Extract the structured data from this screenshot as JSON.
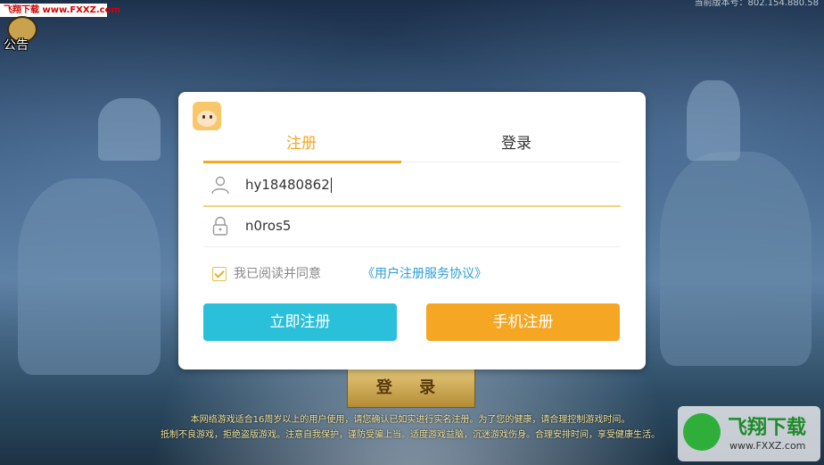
{
  "watermark_top": "飞翔下载 www.FXXZ.com",
  "notice_label": "公告",
  "version_text": "当前版本号：802.154.880.58",
  "dialog": {
    "tabs": [
      {
        "label": "注册",
        "active": true
      },
      {
        "label": "登录",
        "active": false
      }
    ],
    "username_value": "hy18480862",
    "password_value": "n0ros5",
    "user_icon": "user-icon",
    "lock_icon": "lock-icon",
    "agree_text": "我已阅读并同意",
    "agree_link": "《用户注册服务协议》",
    "agree_checked": true,
    "register_button": "立即注册",
    "phone_register_button": "手机注册"
  },
  "game_login_button": "登 录",
  "disclaimer_lines": [
    "本网络游戏适合16周岁以上的用户使用，请您确认已如实进行实名注册。为了您的健康，请合理控制游戏时间。",
    "抵制不良游戏，拒绝盗版游戏。注意自我保护，谨防受骗上当。适度游戏益脑，沉迷游戏伤身。合理安排时间，享受健康生活。"
  ],
  "watermark_bottom": {
    "title": "飞翔下载",
    "url": "www.FXXZ.com"
  },
  "colors": {
    "accent": "#f5a623",
    "primary_button": "#2bc0d9",
    "link": "#2a9fd8"
  }
}
